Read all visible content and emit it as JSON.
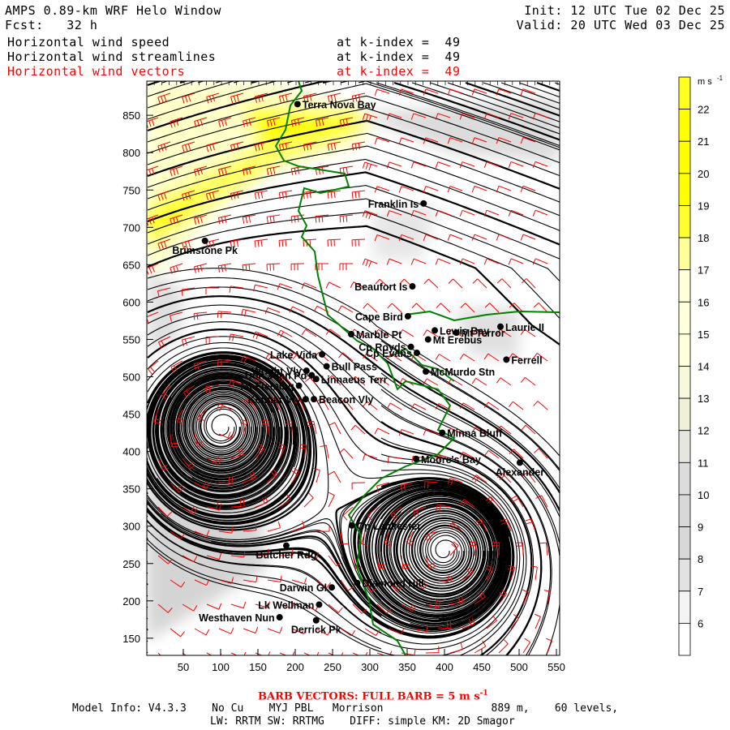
{
  "header": {
    "title": "AMPS 0.89-km WRF Helo Window",
    "forecast": "Fcst:   32 h",
    "init": "Init: 12 UTC Tue 02 Dec 25",
    "valid": "Valid: 20 UTC Wed 03 Dec 25",
    "fields": [
      {
        "name": "Horizontal wind speed",
        "level": "at k-index =  49"
      },
      {
        "name": "Horizontal wind streamlines",
        "level": "at k-index =  49"
      },
      {
        "name": "Horizontal wind vectors",
        "level": "at k-index =  49"
      }
    ]
  },
  "footer": {
    "barb_note": "BARB VECTORS:  FULL BARB = 5 m s",
    "barb_unit_exp": "-1",
    "model_info_1": "Model Info: V4.3.3    No Cu    MYJ PBL   Morrison                 889 m,    60 levels,",
    "model_info_2": "LW: RRTM SW: RRTMG    DIFF: simple KM: 2D Smagor"
  },
  "colorbar": {
    "unit": "m s",
    "unit_exp": "-1",
    "levels": [
      22,
      21,
      20,
      19,
      18,
      17,
      16,
      15,
      14,
      13,
      12,
      11,
      10,
      9,
      8,
      7,
      6
    ],
    "colors": [
      "#ffff20",
      "#ffff00",
      "#ffff00",
      "#ffff00",
      "#ffff30",
      "#ffff9a",
      "#ffffd8",
      "#ffffdc",
      "#ffffdc",
      "#f8f8dc",
      "#f0f0d8",
      "#e6e6e0",
      "#dcdcdc",
      "#d8d8d8",
      "#d8d8d8",
      "#e2e2e2",
      "#f4f4f4",
      "#ffffff"
    ]
  },
  "chart_data": {
    "type": "map",
    "title": "Horizontal wind speed / streamlines / vectors at k-index 49",
    "xlim": [
      0,
      553
    ],
    "ylim": [
      130,
      900
    ],
    "xticks": [
      50,
      100,
      150,
      200,
      250,
      300,
      350,
      400,
      450,
      500,
      550
    ],
    "yticks": [
      150,
      200,
      250,
      300,
      350,
      400,
      450,
      500,
      550,
      600,
      650,
      700,
      750,
      800,
      850
    ],
    "stations": [
      {
        "name": "Terra Nova Bay",
        "x": 203,
        "y": 865,
        "side": "r"
      },
      {
        "name": "Franklin Is",
        "x": 372,
        "y": 732,
        "side": "l"
      },
      {
        "name": "Brimstone Pk",
        "x": 79,
        "y": 682,
        "side": "c"
      },
      {
        "name": "Beaufort Is",
        "x": 357,
        "y": 621,
        "side": "l"
      },
      {
        "name": "Cape Bird",
        "x": 351,
        "y": 581,
        "side": "l"
      },
      {
        "name": "Marble Pt",
        "x": 275,
        "y": 557,
        "side": "r"
      },
      {
        "name": "Lewis Bay",
        "x": 387,
        "y": 562,
        "side": "r"
      },
      {
        "name": "Mt Terror",
        "x": 416,
        "y": 559,
        "side": "r"
      },
      {
        "name": "Laurie II",
        "x": 475,
        "y": 567,
        "side": "r"
      },
      {
        "name": "Mt Erebus",
        "x": 378,
        "y": 550,
        "side": "r"
      },
      {
        "name": "Cp Royds",
        "x": 355,
        "y": 540,
        "side": "l"
      },
      {
        "name": "Cp Evans",
        "x": 363,
        "y": 532,
        "side": "l"
      },
      {
        "name": "Ferrell",
        "x": 483,
        "y": 523,
        "side": "r"
      },
      {
        "name": "McMurdo Stn",
        "x": 375,
        "y": 507,
        "side": "r"
      },
      {
        "name": "Lake Vida",
        "x": 236,
        "y": 530,
        "side": "l"
      },
      {
        "name": "Wright Vly",
        "x": 215,
        "y": 508,
        "side": "l"
      },
      {
        "name": "Bull Pass",
        "x": 242,
        "y": 514,
        "side": "r"
      },
      {
        "name": "Don Juan Pd",
        "x": 222,
        "y": 502,
        "side": "l"
      },
      {
        "name": "Linnaeus Terr",
        "x": 228,
        "y": 497,
        "side": "r"
      },
      {
        "name": "Mt Fleming",
        "x": 205,
        "y": 488,
        "side": "l"
      },
      {
        "name": "Kennar Vly",
        "x": 214,
        "y": 470,
        "side": "l"
      },
      {
        "name": "Beacon Vly",
        "x": 225,
        "y": 470,
        "side": "r"
      },
      {
        "name": "Minna Bluff",
        "x": 397,
        "y": 425,
        "side": "r"
      },
      {
        "name": "Moore's Bay",
        "x": 362,
        "y": 390,
        "side": "r"
      },
      {
        "name": "Alexander",
        "x": 501,
        "y": 385,
        "side": "c"
      },
      {
        "name": "Cp Lankester",
        "x": 276,
        "y": 301,
        "side": "r"
      },
      {
        "name": "Butcher Rdg",
        "x": 188,
        "y": 274,
        "side": "c"
      },
      {
        "name": "Darwin Gl",
        "x": 249,
        "y": 218,
        "side": "l"
      },
      {
        "name": "Diamond Hill",
        "x": 283,
        "y": 224,
        "side": "r"
      },
      {
        "name": "Lk Wellman",
        "x": 232,
        "y": 195,
        "side": "l"
      },
      {
        "name": "Westhaven Nun",
        "x": 179,
        "y": 178,
        "side": "l"
      },
      {
        "name": "Derrick Pk",
        "x": 228,
        "y": 174,
        "side": "c"
      }
    ],
    "vortices": [
      {
        "x": 102,
        "y": 433,
        "sense": "clockwise"
      },
      {
        "x": 400,
        "y": 267,
        "sense": "clockwise"
      }
    ],
    "colors": {
      "streamline": "#000000",
      "barb": "#ff0000",
      "coast": "#008000",
      "station": "#000000"
    }
  }
}
